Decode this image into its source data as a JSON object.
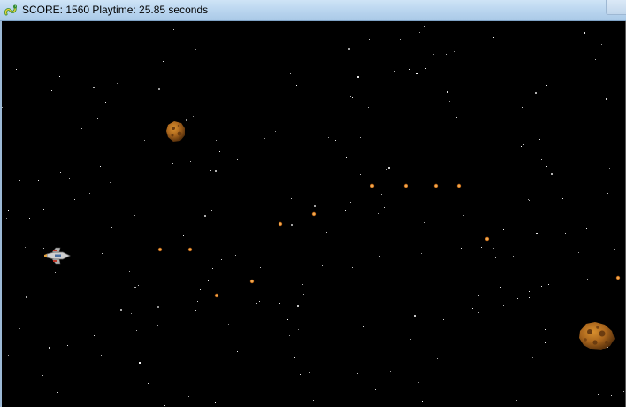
{
  "window": {
    "title": "SCORE: 1560 Playtime: 25.85 seconds"
  },
  "hud": {
    "score": 1560,
    "playtime_seconds": 25.85
  },
  "icons": {
    "app": "pygame-snake-icon"
  },
  "colors": {
    "space": "#000000",
    "star": "#ffffff",
    "bullet": "#e08a2a",
    "asteroid": "#b07020",
    "ship": "#c8c8c8"
  },
  "entities": {
    "player_ship": "spaceship",
    "asteroid_count": 2,
    "bullet_count": 14
  }
}
